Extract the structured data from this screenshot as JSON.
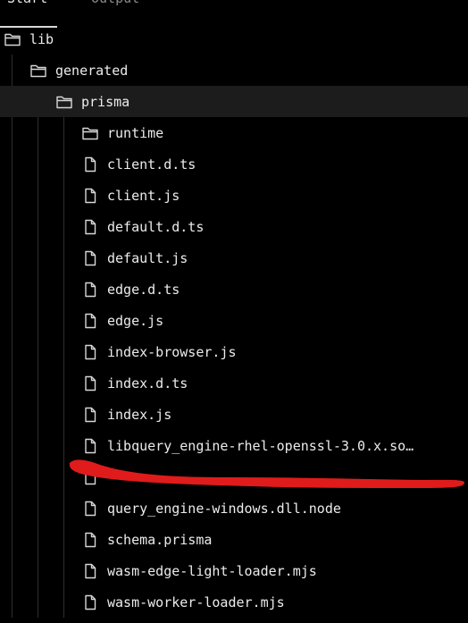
{
  "tabs": [
    {
      "label": "Start"
    },
    {
      "label": "Output"
    }
  ],
  "tree": [
    {
      "name": "lib",
      "type": "folder",
      "depth": 0
    },
    {
      "name": "generated",
      "type": "folder",
      "depth": 1
    },
    {
      "name": "prisma",
      "type": "folder",
      "depth": 2,
      "selected": true
    },
    {
      "name": "runtime",
      "type": "folder",
      "depth": 3
    },
    {
      "name": "client.d.ts",
      "type": "file",
      "depth": 3
    },
    {
      "name": "client.js",
      "type": "file",
      "depth": 3
    },
    {
      "name": "default.d.ts",
      "type": "file",
      "depth": 3
    },
    {
      "name": "default.js",
      "type": "file",
      "depth": 3
    },
    {
      "name": "edge.d.ts",
      "type": "file",
      "depth": 3
    },
    {
      "name": "edge.js",
      "type": "file",
      "depth": 3
    },
    {
      "name": "index-browser.js",
      "type": "file",
      "depth": 3
    },
    {
      "name": "index.d.ts",
      "type": "file",
      "depth": 3
    },
    {
      "name": "index.js",
      "type": "file",
      "depth": 3
    },
    {
      "name": "libquery_engine-rhel-openssl-3.0.x.so…",
      "type": "file",
      "depth": 3
    },
    {
      "name": "",
      "type": "file",
      "depth": 3
    },
    {
      "name": "query_engine-windows.dll.node",
      "type": "file",
      "depth": 3
    },
    {
      "name": "schema.prisma",
      "type": "file",
      "depth": 3
    },
    {
      "name": "wasm-edge-light-loader.mjs",
      "type": "file",
      "depth": 3
    },
    {
      "name": "wasm-worker-loader.mjs",
      "type": "file",
      "depth": 3
    }
  ],
  "colors": {
    "background": "#000000",
    "selected_row": "#1c1c1c",
    "text": "#ececec",
    "icon": "#d6d6d6",
    "guide": "#2e2e2e",
    "annotation": "#e01b1b"
  },
  "icons": {
    "folder": "folder-icon",
    "file": "file-icon"
  }
}
